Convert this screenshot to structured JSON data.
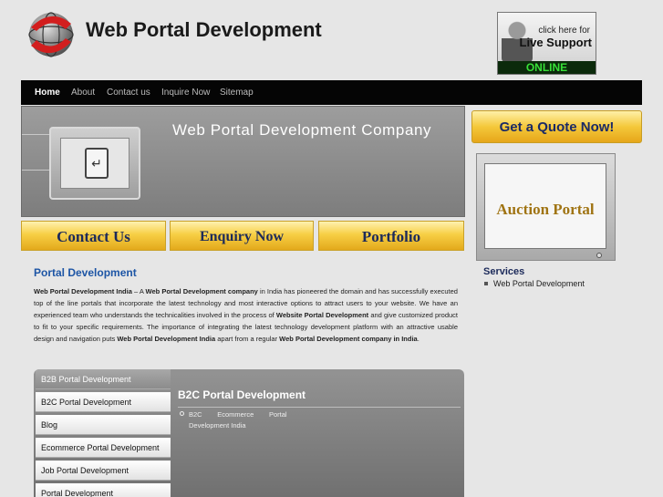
{
  "header": {
    "site_title": "Web Portal Development",
    "live_support": {
      "line1": "click here for",
      "line2": "Live Support",
      "status": "ONLINE"
    }
  },
  "nav": {
    "items": [
      {
        "label": "Home",
        "active": true
      },
      {
        "label": "About"
      },
      {
        "label": "Contact us"
      },
      {
        "label": "Inquire Now"
      },
      {
        "label": "Sitemap"
      }
    ]
  },
  "banner": {
    "title": "Web Portal Development Company"
  },
  "buttons": {
    "contact": "Contact Us",
    "enquiry": "Enquiry Now",
    "portfolio": "Portfolio",
    "quote": "Get a Quote Now!"
  },
  "sidebar": {
    "auction": "Auction Portal",
    "services_title": "Services",
    "services_items": [
      "Web Portal Development"
    ]
  },
  "main": {
    "heading": "Portal Development",
    "para": {
      "b1": "Web Portal Development India",
      "t1": " – A ",
      "b2": "Web Portal Development company",
      "t2": " in India has pioneered the domain and has successfully executed top of the line portals that incorporate the latest technology and most interactive options to attract users to your website. We have an experienced team who understands the technicalities involved in the process of ",
      "b3": "Website Portal Development",
      "t3": " and give customized product to fit to your specific requirements. The importance of integrating the latest technology development platform with an attractive usable design and navigation puts ",
      "b4": "Web Portal Development India",
      "t4": " apart from a regular ",
      "b5": "Web Portal Development company in India",
      "t5": "."
    }
  },
  "tabs": {
    "items": [
      "B2B Portal Development",
      "B2C Portal Development",
      "Blog",
      "Ecommerce Portal Development",
      "Job Portal Development",
      "Portal Development"
    ],
    "active_index": 0,
    "pane_title": "B2C Portal Development",
    "pane_item_line1": "B2C        Ecommerce        Portal",
    "pane_item_line2": "Development India"
  },
  "colors": {
    "nav_bg": "#050505",
    "heading_blue": "#1d55a5",
    "button_gold": "#f4c83a",
    "online_green": "#38e038"
  }
}
